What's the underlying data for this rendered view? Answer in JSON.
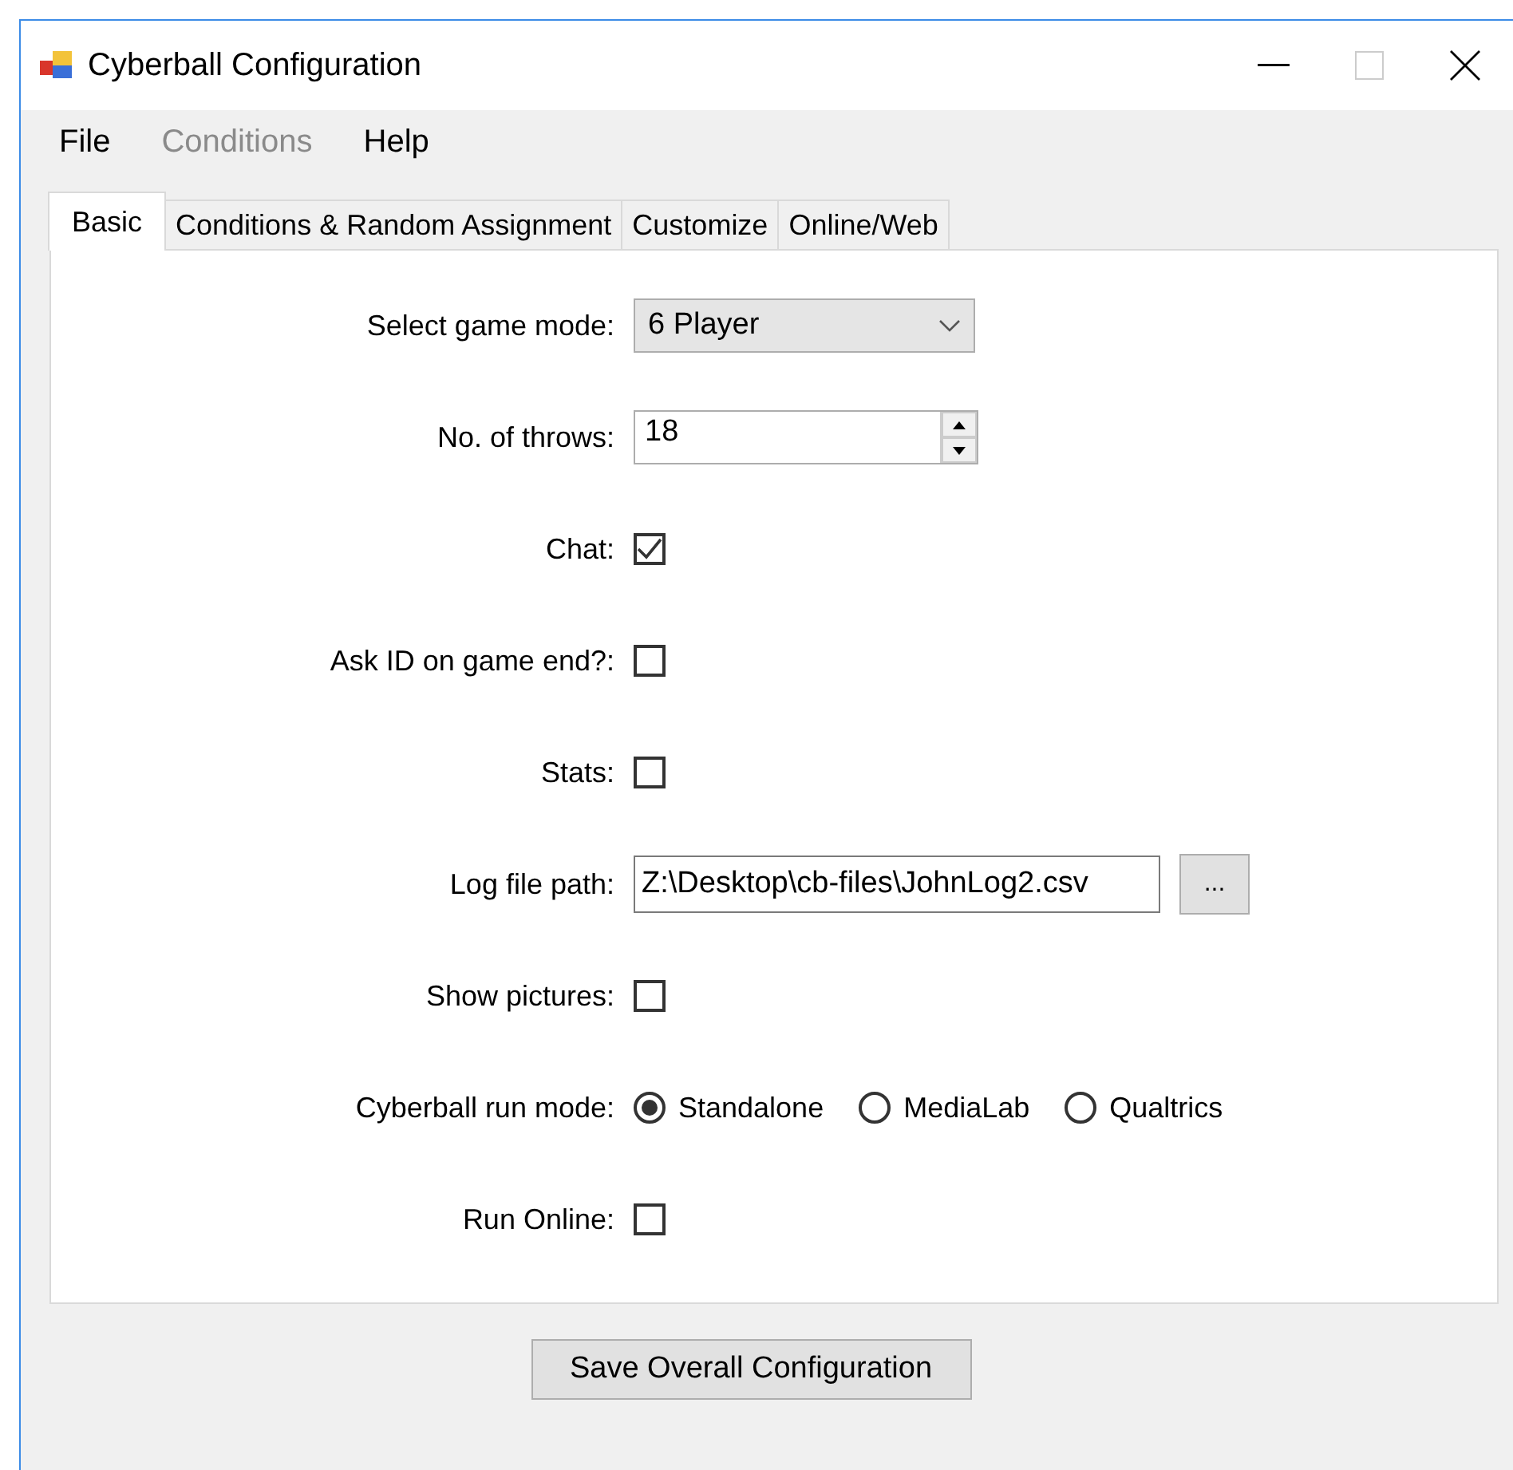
{
  "window": {
    "title": "Cyberball Configuration"
  },
  "menu": [
    {
      "label": "File",
      "disabled": false
    },
    {
      "label": "Conditions",
      "disabled": true
    },
    {
      "label": "Help",
      "disabled": false
    }
  ],
  "tabs": [
    {
      "label": "Basic",
      "selected": true
    },
    {
      "label": "Conditions & Random Assignment",
      "selected": false
    },
    {
      "label": "Customize",
      "selected": false
    },
    {
      "label": "Online/Web",
      "selected": false
    }
  ],
  "fields": [
    {
      "kind": "select",
      "label": "Select game mode:",
      "value": "6 Player"
    },
    {
      "kind": "spinner",
      "label": "No. of throws:",
      "value": "18"
    },
    {
      "kind": "checkbox",
      "label": "Chat:",
      "checked": true
    },
    {
      "kind": "checkbox",
      "label": "Ask ID on game end?:",
      "checked": false
    },
    {
      "kind": "checkbox",
      "label": "Stats:",
      "checked": false
    },
    {
      "kind": "path",
      "label": "Log file path:",
      "value": "Z:\\Desktop\\cb-files\\JohnLog2.csv",
      "button": "..."
    },
    {
      "kind": "checkbox",
      "label": "Show pictures:",
      "checked": false
    },
    {
      "kind": "radio",
      "label": "Cyberball run mode:",
      "options": [
        {
          "label": "Standalone",
          "selected": true
        },
        {
          "label": "MediaLab",
          "selected": false
        },
        {
          "label": "Qualtrics",
          "selected": false
        }
      ]
    },
    {
      "kind": "checkbox",
      "label": "Run Online:",
      "checked": false
    }
  ],
  "save_button": "Save Overall Configuration"
}
